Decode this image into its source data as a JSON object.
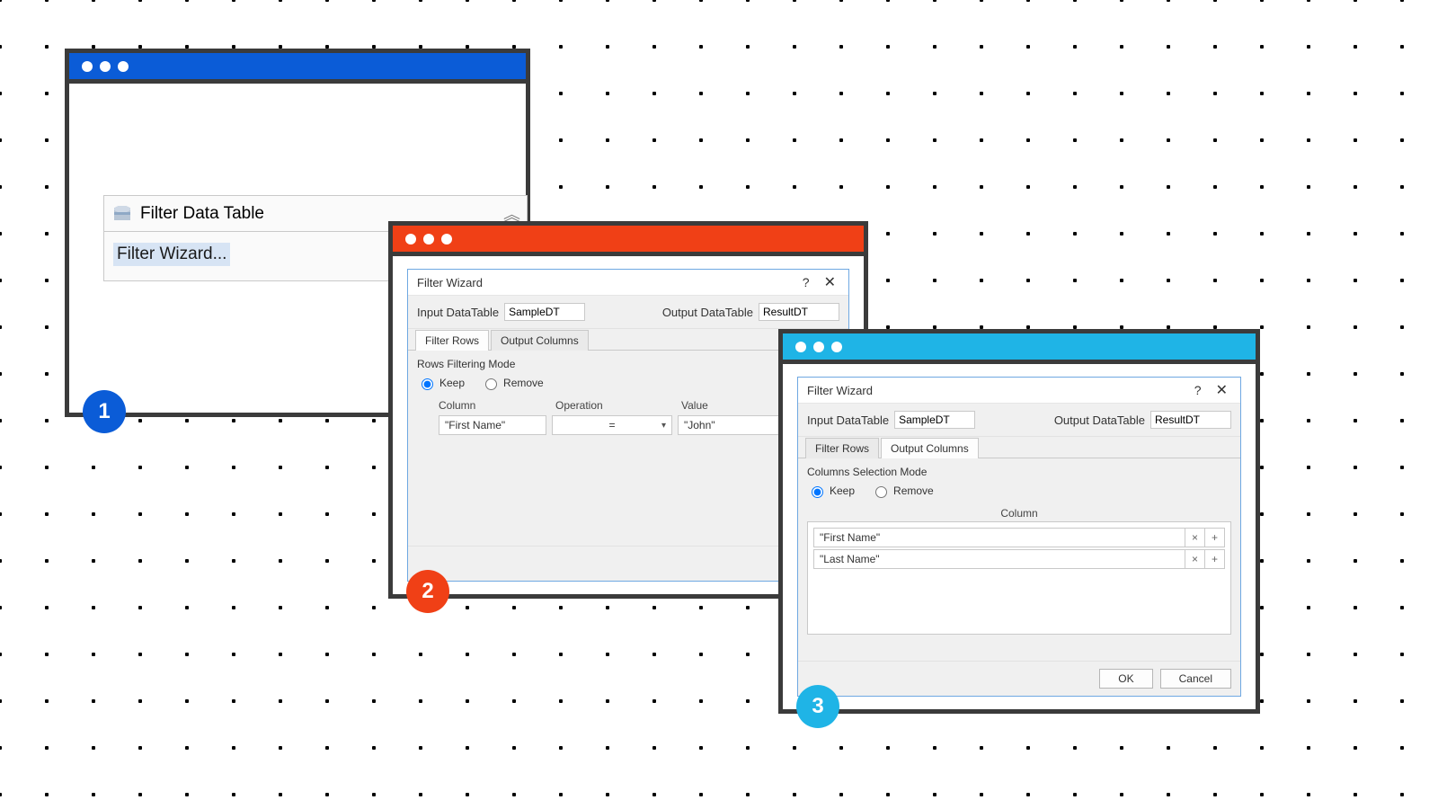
{
  "badges": {
    "one": "1",
    "two": "2",
    "three": "3"
  },
  "colors": {
    "blue": "#0b5cd7",
    "orange": "#f04016",
    "cyan": "#1fb4e6",
    "frame": "#3b3b3b"
  },
  "frame1": {
    "activity_title": "Filter Data Table",
    "activity_link": "Filter Wizard..."
  },
  "dlg_common": {
    "title": "Filter Wizard",
    "help": "?",
    "close": "✕",
    "input_label": "Input DataTable",
    "input_value": "SampleDT",
    "output_label": "Output DataTable",
    "output_value": "ResultDT",
    "tab_rows": "Filter Rows",
    "tab_cols": "Output Columns",
    "keep": "Keep",
    "remove": "Remove",
    "ok": "OK",
    "cancel": "Cancel"
  },
  "frame2": {
    "mode_label": "Rows Filtering Mode",
    "hdr_column": "Column",
    "hdr_operation": "Operation",
    "hdr_value": "Value",
    "row": {
      "column": "\"First Name\"",
      "operation": "=",
      "value": "\"John\""
    }
  },
  "frame3": {
    "mode_label": "Columns Selection Mode",
    "hdr_column": "Column",
    "rows": [
      {
        "col": "\"First Name\""
      },
      {
        "col": "\"Last Name\""
      }
    ],
    "btn_x": "×",
    "btn_plus": "+"
  }
}
